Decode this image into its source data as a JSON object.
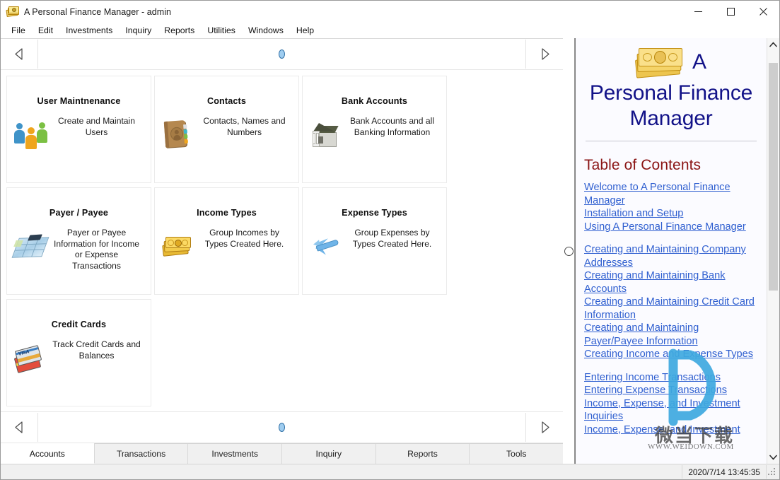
{
  "window": {
    "title": "A Personal Finance Manager - admin",
    "icon": "money-stack-icon",
    "minimize_label": "Minimize",
    "maximize_label": "Maximize",
    "close_label": "Close"
  },
  "menu": {
    "items": [
      {
        "label": "File"
      },
      {
        "label": "Edit"
      },
      {
        "label": "Investments"
      },
      {
        "label": "Inquiry"
      },
      {
        "label": "Reports"
      },
      {
        "label": "Utilities"
      },
      {
        "label": "Windows"
      },
      {
        "label": "Help"
      }
    ]
  },
  "nav": {
    "prev_label": "Previous page",
    "next_label": "Next page",
    "page_indicator": "1"
  },
  "tiles": [
    {
      "title": "User Maintnenance",
      "description": "Create and Maintain Users",
      "icon": "people-group-icon"
    },
    {
      "title": "Contacts",
      "description": "Contacts, Names and Numbers",
      "icon": "address-book-icon"
    },
    {
      "title": "Bank Accounts",
      "description": "Bank Accounts and all Banking Information",
      "icon": "bank-building-icon"
    },
    {
      "title": "Payer / Payee",
      "description": "Payer or Payee Information for Income or Expense Transactions",
      "icon": "ledger-grid-icon"
    },
    {
      "title": "Income Types",
      "description": "Group Incomes by Types Created Here.",
      "icon": "money-stack-icon"
    },
    {
      "title": "Expense Types",
      "description": "Group Expenses by Types Created Here.",
      "icon": "airplane-icon"
    },
    {
      "title": "Credit Cards",
      "description": "Track Credit Cards and Balances",
      "icon": "credit-cards-icon"
    }
  ],
  "tabs": [
    {
      "label": "Accounts",
      "active": true
    },
    {
      "label": "Transactions",
      "active": false
    },
    {
      "label": "Investments",
      "active": false
    },
    {
      "label": "Inquiry",
      "active": false
    },
    {
      "label": "Reports",
      "active": false
    },
    {
      "label": "Tools",
      "active": false
    }
  ],
  "help": {
    "logo_letter": "A",
    "title": "Personal Finance Manager",
    "toc_heading": "Table of Contents",
    "groups": [
      {
        "links": [
          "Welcome to A Personal Finance Manager",
          "Installation and Setup",
          "Using A Personal Finance Manager"
        ]
      },
      {
        "links": [
          "Creating and Maintaining Company Addresses",
          "Creating and Maintaining Bank Accounts",
          "Creating and Maintaining Credit Card Information",
          "Creating and Maintaining Payer/Payee Information",
          "Creating Income and Expense Types"
        ]
      },
      {
        "links": [
          "Entering Income Transactions",
          "Entering Expense Transactions",
          "Income, Expense, and Investment Inquiries",
          "Income, Expense, and Investment"
        ]
      }
    ],
    "watermark": {
      "logo": "D",
      "chinese": "微当下载",
      "url": "WWW.WEIDOWN.COM"
    },
    "scroll_up_label": "Scroll up",
    "scroll_down_label": "Scroll down"
  },
  "status": {
    "timestamp": "2020/7/14 13:45:35"
  },
  "colors": {
    "help_title": "#121288",
    "toc_heading": "#8a1414",
    "link": "#2f5fd0",
    "watermark": "#3fa9e0"
  }
}
